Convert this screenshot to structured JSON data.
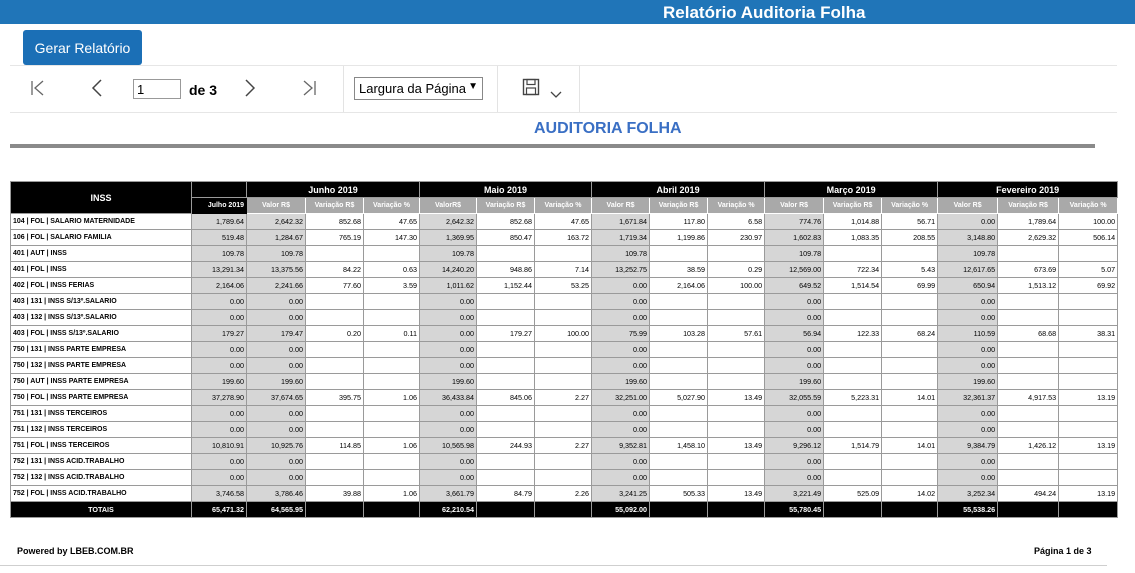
{
  "app": {
    "title": "Relatório Auditoria Folha"
  },
  "actions": {
    "generate_label": "Gerar Relatório"
  },
  "toolbar": {
    "page_value": "1",
    "page_of": "de 3",
    "zoom_value": "Largura da Página",
    "icons": [
      "first-page-icon",
      "prev-page-icon",
      "next-page-icon",
      "last-page-icon",
      "save-icon",
      "chevron-down-icon"
    ]
  },
  "report": {
    "title": "AUDITORIA FOLHA",
    "section": "INSS",
    "months": [
      "Junho 2019",
      "Maio 2019",
      "Abril 2019",
      "Março 2019",
      "Fevereiro 2019"
    ],
    "current_col": "Julho 2019",
    "subcols": [
      [
        "Valor R$",
        "Variação R$",
        "Variação %"
      ],
      [
        "ValorR$",
        "Variação R$",
        "Variação %"
      ],
      [
        "Valor R$",
        "Variação R$",
        "Variação %"
      ],
      [
        "Valor R$",
        "Variação R$",
        "Variação %"
      ],
      [
        "Valor R$",
        "Variação R$",
        "Variação %"
      ]
    ],
    "rows": [
      {
        "label": "104 | FOL | SALARIO MATERNIDADE",
        "cells": [
          "1,789.64",
          "2,642.32",
          "852.68",
          "47.65",
          "2,642.32",
          "852.68",
          "47.65",
          "1,671.84",
          "117.80",
          "6.58",
          "774.76",
          "1,014.88",
          "56.71",
          "0.00",
          "1,789.64",
          "100.00"
        ]
      },
      {
        "label": "106 | FOL | SALARIO FAMILIA",
        "cells": [
          "519.48",
          "1,284.67",
          "765.19",
          "147.30",
          "1,369.95",
          "850.47",
          "163.72",
          "1,719.34",
          "1,199.86",
          "230.97",
          "1,602.83",
          "1,083.35",
          "208.55",
          "3,148.80",
          "2,629.32",
          "506.14"
        ]
      },
      {
        "label": "401 | AUT | INSS",
        "cells": [
          "109.78",
          "109.78",
          "",
          "",
          "109.78",
          "",
          "",
          "109.78",
          "",
          "",
          "109.78",
          "",
          "",
          "109.78",
          "",
          ""
        ]
      },
      {
        "label": "401 | FOL | INSS",
        "cells": [
          "13,291.34",
          "13,375.56",
          "84.22",
          "0.63",
          "14,240.20",
          "948.86",
          "7.14",
          "13,252.75",
          "38.59",
          "0.29",
          "12,569.00",
          "722.34",
          "5.43",
          "12,617.65",
          "673.69",
          "5.07"
        ]
      },
      {
        "label": "402 | FOL | INSS FERIAS",
        "cells": [
          "2,164.06",
          "2,241.66",
          "77.60",
          "3.59",
          "1,011.62",
          "1,152.44",
          "53.25",
          "0.00",
          "2,164.06",
          "100.00",
          "649.52",
          "1,514.54",
          "69.99",
          "650.94",
          "1,513.12",
          "69.92"
        ]
      },
      {
        "label": "403 | 131 | INSS S/13º.SALARIO",
        "cells": [
          "0.00",
          "0.00",
          "",
          "",
          "0.00",
          "",
          "",
          "0.00",
          "",
          "",
          "0.00",
          "",
          "",
          "0.00",
          "",
          ""
        ]
      },
      {
        "label": "403 | 132 | INSS S/13º.SALARIO",
        "cells": [
          "0.00",
          "0.00",
          "",
          "",
          "0.00",
          "",
          "",
          "0.00",
          "",
          "",
          "0.00",
          "",
          "",
          "0.00",
          "",
          ""
        ]
      },
      {
        "label": "403 | FOL | INSS S/13º.SALARIO",
        "cells": [
          "179.27",
          "179.47",
          "0.20",
          "0.11",
          "0.00",
          "179.27",
          "100.00",
          "75.99",
          "103.28",
          "57.61",
          "56.94",
          "122.33",
          "68.24",
          "110.59",
          "68.68",
          "38.31"
        ]
      },
      {
        "label": "750 | 131 | INSS PARTE EMPRESA",
        "cells": [
          "0.00",
          "0.00",
          "",
          "",
          "0.00",
          "",
          "",
          "0.00",
          "",
          "",
          "0.00",
          "",
          "",
          "0.00",
          "",
          ""
        ]
      },
      {
        "label": "750 | 132 | INSS PARTE EMPRESA",
        "cells": [
          "0.00",
          "0.00",
          "",
          "",
          "0.00",
          "",
          "",
          "0.00",
          "",
          "",
          "0.00",
          "",
          "",
          "0.00",
          "",
          ""
        ]
      },
      {
        "label": "750 | AUT | INSS PARTE EMPRESA",
        "cells": [
          "199.60",
          "199.60",
          "",
          "",
          "199.60",
          "",
          "",
          "199.60",
          "",
          "",
          "199.60",
          "",
          "",
          "199.60",
          "",
          ""
        ]
      },
      {
        "label": "750 | FOL | INSS PARTE EMPRESA",
        "cells": [
          "37,278.90",
          "37,674.65",
          "395.75",
          "1.06",
          "36,433.84",
          "845.06",
          "2.27",
          "32,251.00",
          "5,027.90",
          "13.49",
          "32,055.59",
          "5,223.31",
          "14.01",
          "32,361.37",
          "4,917.53",
          "13.19"
        ]
      },
      {
        "label": "751 | 131 | INSS TERCEIROS",
        "cells": [
          "0.00",
          "0.00",
          "",
          "",
          "0.00",
          "",
          "",
          "0.00",
          "",
          "",
          "0.00",
          "",
          "",
          "0.00",
          "",
          ""
        ]
      },
      {
        "label": "751 | 132 | INSS TERCEIROS",
        "cells": [
          "0.00",
          "0.00",
          "",
          "",
          "0.00",
          "",
          "",
          "0.00",
          "",
          "",
          "0.00",
          "",
          "",
          "0.00",
          "",
          ""
        ]
      },
      {
        "label": "751 | FOL | INSS TERCEIROS",
        "cells": [
          "10,810.91",
          "10,925.76",
          "114.85",
          "1.06",
          "10,565.98",
          "244.93",
          "2.27",
          "9,352.81",
          "1,458.10",
          "13.49",
          "9,296.12",
          "1,514.79",
          "14.01",
          "9,384.79",
          "1,426.12",
          "13.19"
        ]
      },
      {
        "label": "752 | 131 | INSS ACID.TRABALHO",
        "cells": [
          "0.00",
          "0.00",
          "",
          "",
          "0.00",
          "",
          "",
          "0.00",
          "",
          "",
          "0.00",
          "",
          "",
          "0.00",
          "",
          ""
        ]
      },
      {
        "label": "752 | 132 | INSS ACID.TRABALHO",
        "cells": [
          "0.00",
          "0.00",
          "",
          "",
          "0.00",
          "",
          "",
          "0.00",
          "",
          "",
          "0.00",
          "",
          "",
          "0.00",
          "",
          ""
        ]
      },
      {
        "label": "752 | FOL | INSS ACID.TRABALHO",
        "cells": [
          "3,746.58",
          "3,786.46",
          "39.88",
          "1.06",
          "3,661.79",
          "84.79",
          "2.26",
          "3,241.25",
          "505.33",
          "13.49",
          "3,221.49",
          "525.09",
          "14.02",
          "3,252.34",
          "494.24",
          "13.19"
        ]
      }
    ],
    "totals": {
      "label": "TOTAIS",
      "cells": [
        "65,471.32",
        "64,565.95",
        "",
        "",
        "62,210.54",
        "",
        "",
        "55,092.00",
        "",
        "",
        "55,780.45",
        "",
        "",
        "55,538.26",
        "",
        ""
      ]
    }
  },
  "footer": {
    "powered_by": "Powered by LBEB.COM.BR",
    "page_info": "Página 1 de 3"
  }
}
